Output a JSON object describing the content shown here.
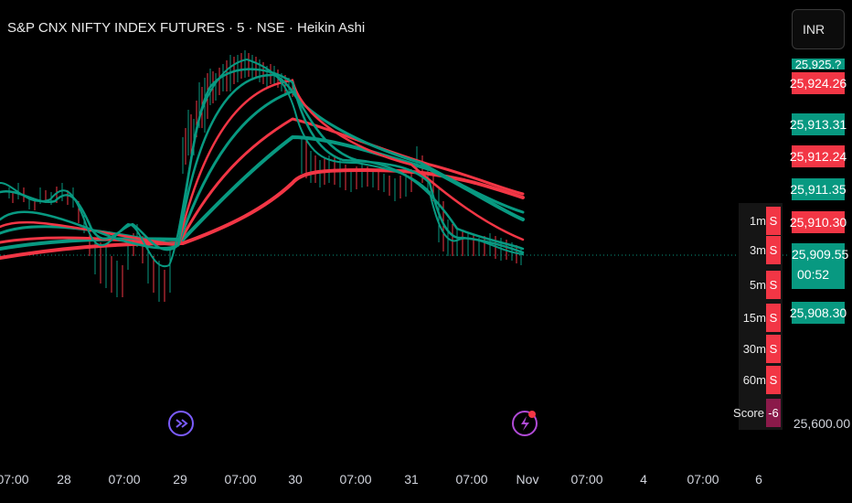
{
  "header": {
    "title": "S&P CNX NIFTY INDEX FUTURES · 5 · NSE · Heikin Ashi"
  },
  "currency": {
    "label": "INR"
  },
  "price_axis": {
    "top_partial": "25,925.?",
    "tags": [
      {
        "value": "25,924.26",
        "color": "#f23645"
      },
      {
        "value": "25,913.31",
        "color": "#089981"
      },
      {
        "value": "25,912.24",
        "color": "#f23645"
      },
      {
        "value": "25,911.35",
        "color": "#089981"
      },
      {
        "value": "25,910.30",
        "color": "#f23645"
      },
      {
        "value": "25,909.55",
        "color": "#089981"
      }
    ],
    "current_price": "25,909.55",
    "countdown": "00:52",
    "last_tag": {
      "value": "25,908.30",
      "color": "#089981"
    },
    "bottom_label": "25,600.00"
  },
  "time_axis": {
    "labels": [
      "07:00",
      "28",
      "07:00",
      "29",
      "07:00",
      "30",
      "07:00",
      "31",
      "07:00",
      "Nov",
      "07:00",
      "4",
      "07:00",
      "6"
    ]
  },
  "mtf_table": {
    "rows": [
      {
        "tf": "1m",
        "signal": "S"
      },
      {
        "tf": "3m",
        "signal": "S"
      },
      {
        "tf": "5m",
        "signal": "S"
      },
      {
        "tf": "15m",
        "signal": "S"
      },
      {
        "tf": "30m",
        "signal": "S"
      },
      {
        "tf": "60m",
        "signal": "S"
      }
    ],
    "score_label": "Score",
    "score_value": "-6"
  },
  "colors": {
    "bull": "#089981",
    "bear": "#f23645",
    "score_bg": "#8b1a4a",
    "event_purple": "#7b5cff",
    "event_violet": "#b04ad6"
  },
  "icons": {
    "event_1": "forward-arrow-icon",
    "event_2": "lightning-icon"
  }
}
